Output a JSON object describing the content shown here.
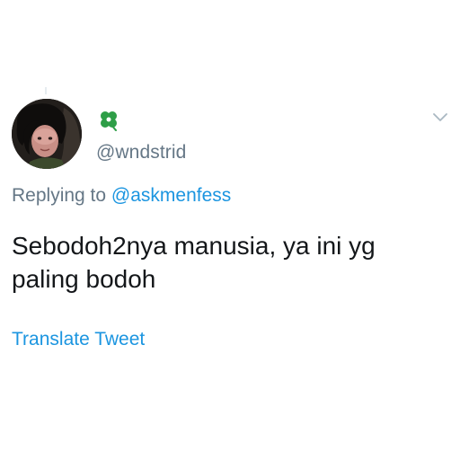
{
  "tweet": {
    "handle": "@wndstrid",
    "replying_prefix": "Replying to",
    "replying_mention": "@askmenfess",
    "text": "Sebodoh2nya manusia, ya ini yg paling bodoh",
    "translate_label": "Translate Tweet",
    "badge_icon": "four-leaf-clover-icon",
    "menu_icon": "chevron-down-icon",
    "colors": {
      "link": "#1b95e0",
      "secondary": "#657786",
      "primary_text": "#14171a",
      "clover": "#2e9e47"
    }
  }
}
